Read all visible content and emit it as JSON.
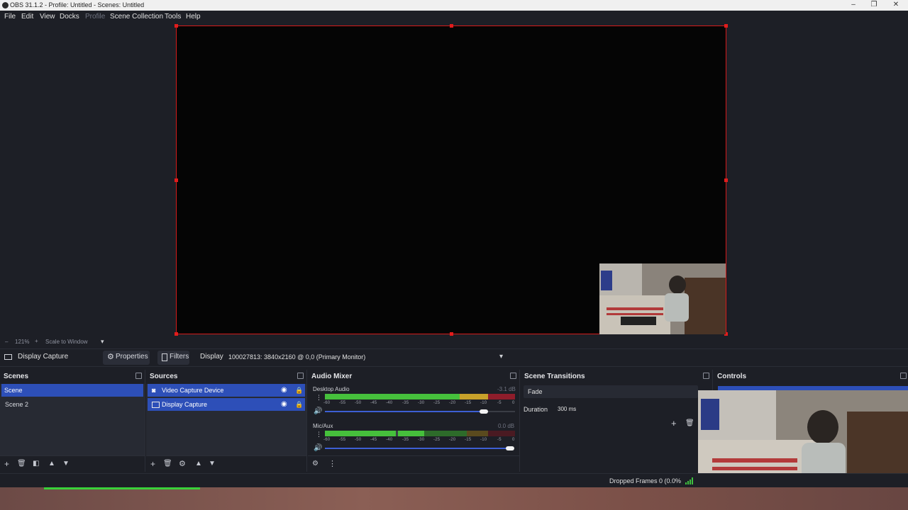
{
  "window": {
    "title": "OBS 31.1.2 - Profile: Untitled - Scenes: Untitled"
  },
  "menu": {
    "items": [
      {
        "label": "File"
      },
      {
        "label": "Edit"
      },
      {
        "label": "View"
      },
      {
        "label": "Docks"
      },
      {
        "label": "Profile"
      },
      {
        "label": "Scene Collection"
      },
      {
        "label": "Tools"
      },
      {
        "label": "Help"
      }
    ]
  },
  "preview": {
    "zoom": "121%",
    "scale_mode": "Scale to Window"
  },
  "source_toolbar": {
    "selected_source": "Display Capture",
    "properties_label": "Properties",
    "filters_label": "Filters",
    "display_label": "Display",
    "display_value": "100027813: 3840x2160 @ 0,0 (Primary Monitor)"
  },
  "scenes": {
    "title": "Scenes",
    "items": [
      {
        "label": "Scene",
        "selected": true
      },
      {
        "label": "Scene 2",
        "selected": false
      }
    ]
  },
  "sources": {
    "title": "Sources",
    "items": [
      {
        "label": "Video Capture Device"
      },
      {
        "label": "Display Capture"
      }
    ]
  },
  "audio_mixer": {
    "title": "Audio Mixer",
    "channels": [
      {
        "name": "Desktop Audio",
        "db": "-3.1 dB",
        "volume": 0.84
      },
      {
        "name": "Mic/Aux",
        "db": "0.0 dB",
        "volume": 0.98
      }
    ],
    "scale": [
      "-60",
      "-55",
      "-50",
      "-45",
      "-40",
      "-35",
      "-30",
      "-25",
      "-20",
      "-15",
      "-10",
      "-5",
      "0"
    ]
  },
  "scene_transitions": {
    "title": "Scene Transitions",
    "transition": "Fade",
    "duration_label": "Duration",
    "duration_value": "300 ms"
  },
  "controls": {
    "title": "Controls"
  },
  "status": {
    "dropped_frames": "Dropped Frames 0 (0.0%"
  },
  "colors": {
    "accent": "#2d4fb8",
    "selection_border": "#d61b1b"
  }
}
